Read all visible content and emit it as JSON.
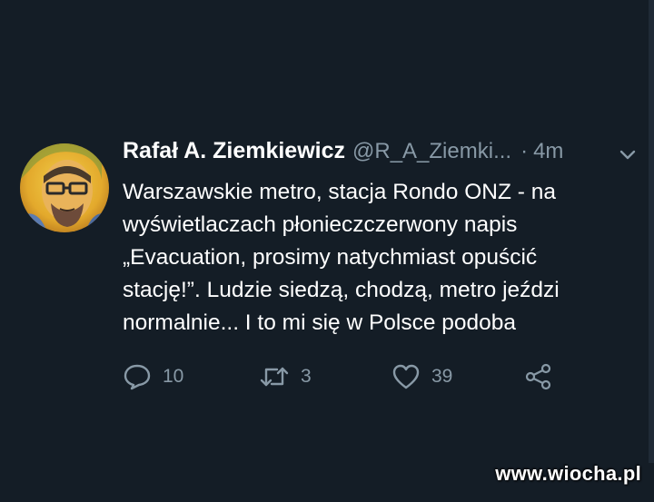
{
  "colors": {
    "background": "#141d26",
    "text_primary": "#ffffff",
    "text_secondary": "#8899a6"
  },
  "tweet": {
    "author_name": "Rafał A. Ziemkiewicz",
    "handle": "@R_A_Ziemki...",
    "separator": "·",
    "time": "4m",
    "text_lines": [
      "Warszawskie metro, stacja Rondo ONZ - na",
      "wyświetlaczach płonieczczerwony napis",
      "„Evacuation, prosimy natychmiast opuścić",
      "stację!”. Ludzie siedzą, chodzą, metro jeździ",
      "normalnie... I to mi się w Polsce podoba"
    ],
    "actions": {
      "reply_count": "10",
      "retweet_count": "3",
      "like_count": "39"
    },
    "icons": {
      "menu": "chevron-down-icon",
      "reply": "reply-icon",
      "retweet": "retweet-icon",
      "like": "heart-icon",
      "share": "share-icon"
    }
  },
  "watermark": "www.wiocha.pl"
}
